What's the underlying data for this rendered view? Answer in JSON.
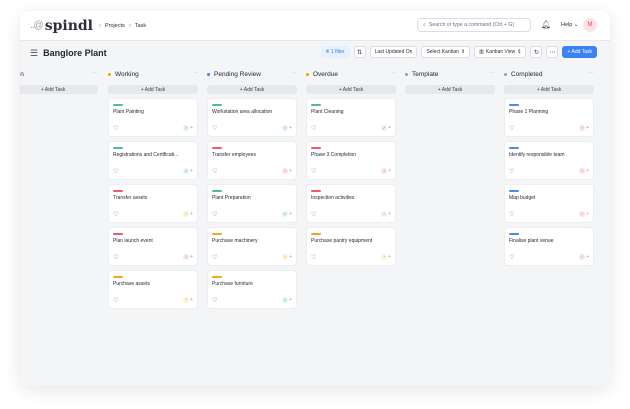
{
  "app": {
    "logo_mark": "..@",
    "logo_text": "spindl"
  },
  "breadcrumb": [
    "Projects",
    "Task"
  ],
  "search": {
    "placeholder": "Search or type a command (Ctrl + G)"
  },
  "header": {
    "help": "Help",
    "avatar": "M"
  },
  "toolbar": {
    "title": "Banglore Plant",
    "filter": "1 filter",
    "sort": "Last Updated On",
    "kanban_select": "Select Kanban",
    "kanban_view": "Kanban View",
    "add_task": "+ Add Task"
  },
  "add_task_label": "+ Add Task",
  "colors": {
    "green": "#4fc08d",
    "red": "#ef5a6f",
    "orange": "#f5a623",
    "blue": "#4a8fe7"
  },
  "columns": [
    {
      "name": "Open",
      "dot": "",
      "cards": []
    },
    {
      "name": "Working",
      "dot": "#f59e0b",
      "cards": [
        {
          "title": "Plant Painting",
          "bar": "#4fc08d",
          "status": "done"
        },
        {
          "title": "Registrations and Certificati...",
          "bar": "#4fc08d",
          "status": "done"
        },
        {
          "title": "Transfer assets",
          "bar": "#ef5a6f",
          "status": "warn"
        },
        {
          "title": "Plan launch event",
          "bar": "#ef5a6f",
          "status": "alert"
        },
        {
          "title": "Purchase assets",
          "bar": "#f5a623",
          "status": "warn"
        }
      ]
    },
    {
      "name": "Pending Review",
      "dot": "#3b82f6",
      "cards": [
        {
          "title": "Workstation area allocation",
          "bar": "#4fc08d",
          "status": "done"
        },
        {
          "title": "Transfer employees",
          "bar": "#ef5a6f",
          "status": "alert"
        },
        {
          "title": "Plant Preparation",
          "bar": "#4fc08d",
          "status": "done"
        },
        {
          "title": "Purchase machinery",
          "bar": "#f5a623",
          "status": "warn"
        },
        {
          "title": "Purchase furniture",
          "bar": "#f5a623",
          "status": "done"
        }
      ]
    },
    {
      "name": "Overdue",
      "dot": "#f59e0b",
      "cards": [
        {
          "title": "Plant Cleaning",
          "bar": "#4fc08d",
          "status": "done"
        },
        {
          "title": "Phase 3 Completion",
          "bar": "#ef5a6f",
          "status": "alert"
        },
        {
          "title": "Inspection activities",
          "bar": "#ef5a6f",
          "status": "idle"
        },
        {
          "title": "Purchase pantry equipment",
          "bar": "#f5a623",
          "status": "warn"
        }
      ]
    },
    {
      "name": "Template",
      "dot": "#9aa0a6",
      "cards": []
    },
    {
      "name": "Completed",
      "dot": "#9aa0a6",
      "cards": [
        {
          "title": "Phase 1 Planning",
          "bar": "#4a8fe7",
          "status": "alert"
        },
        {
          "title": "Identify responsible team",
          "bar": "#4a8fe7",
          "status": "alert"
        },
        {
          "title": "Map budget",
          "bar": "#4a8fe7",
          "status": "alert"
        },
        {
          "title": "Finalise plant venue",
          "bar": "#4a8fe7",
          "status": "alert"
        }
      ]
    }
  ]
}
